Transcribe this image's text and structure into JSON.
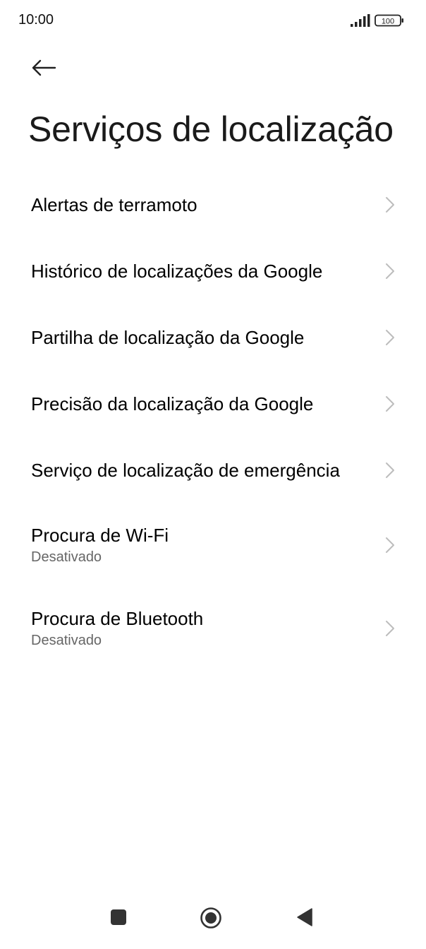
{
  "status_bar": {
    "time": "10:00",
    "battery": "100",
    "icons": [
      "signal-icon",
      "battery-icon"
    ]
  },
  "header": {
    "back_icon": "arrow-left-icon",
    "title": "Serviços de localização"
  },
  "items": [
    {
      "title": "Alertas de terramoto"
    },
    {
      "title": "Histórico de localizações da Google"
    },
    {
      "title": "Partilha de localização da Google"
    },
    {
      "title": "Precisão da localização da Google"
    },
    {
      "title": "Serviço de localização de emergência"
    },
    {
      "title": "Procura de Wi-Fi",
      "summary": "Desativado"
    },
    {
      "title": "Procura de Bluetooth",
      "summary": "Desativado"
    }
  ],
  "nav_bar": {
    "icons": [
      "recents-square-icon",
      "home-circle-icon",
      "back-triangle-icon"
    ]
  },
  "colors": {
    "background": "#ffffff",
    "text_primary": "#000000",
    "text_secondary": "#666666",
    "chevron": "#bdbdbd",
    "nav_icon": "#333333"
  }
}
